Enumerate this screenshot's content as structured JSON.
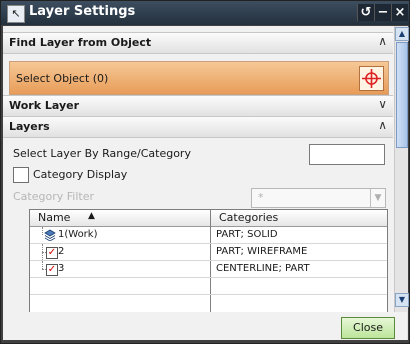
{
  "window": {
    "title": "Layer Settings",
    "reset_glyph": "↺",
    "minimize_glyph": "−",
    "close_glyph": "×"
  },
  "sections": {
    "find_layer": "Find Layer from Object",
    "select_object": "Select Object (0)",
    "work_layer": "Work Layer",
    "layers": "Layers"
  },
  "layers_panel": {
    "range_label": "Select Layer By Range/Category",
    "range_value": "",
    "category_display_label": "Category Display",
    "category_display_checked": false,
    "category_filter_label": "Category Filter",
    "category_filter_value": "*"
  },
  "table": {
    "columns": {
      "name": "Name",
      "categories": "Categories"
    },
    "sort_indicator": "▲",
    "rows": [
      {
        "name": "1(Work)",
        "categories": "PART; SOLID",
        "checked": null
      },
      {
        "name": "2",
        "categories": "PART; WIREFRAME",
        "checked": true
      },
      {
        "name": "3",
        "categories": "CENTERLINE; PART",
        "checked": true
      }
    ]
  },
  "footer": {
    "close_label": "Close"
  },
  "colors": {
    "title_bar": "#2b3847",
    "select_highlight": "#eea765",
    "close_button": "#c7e9a6",
    "check_mark": "#d00000"
  }
}
